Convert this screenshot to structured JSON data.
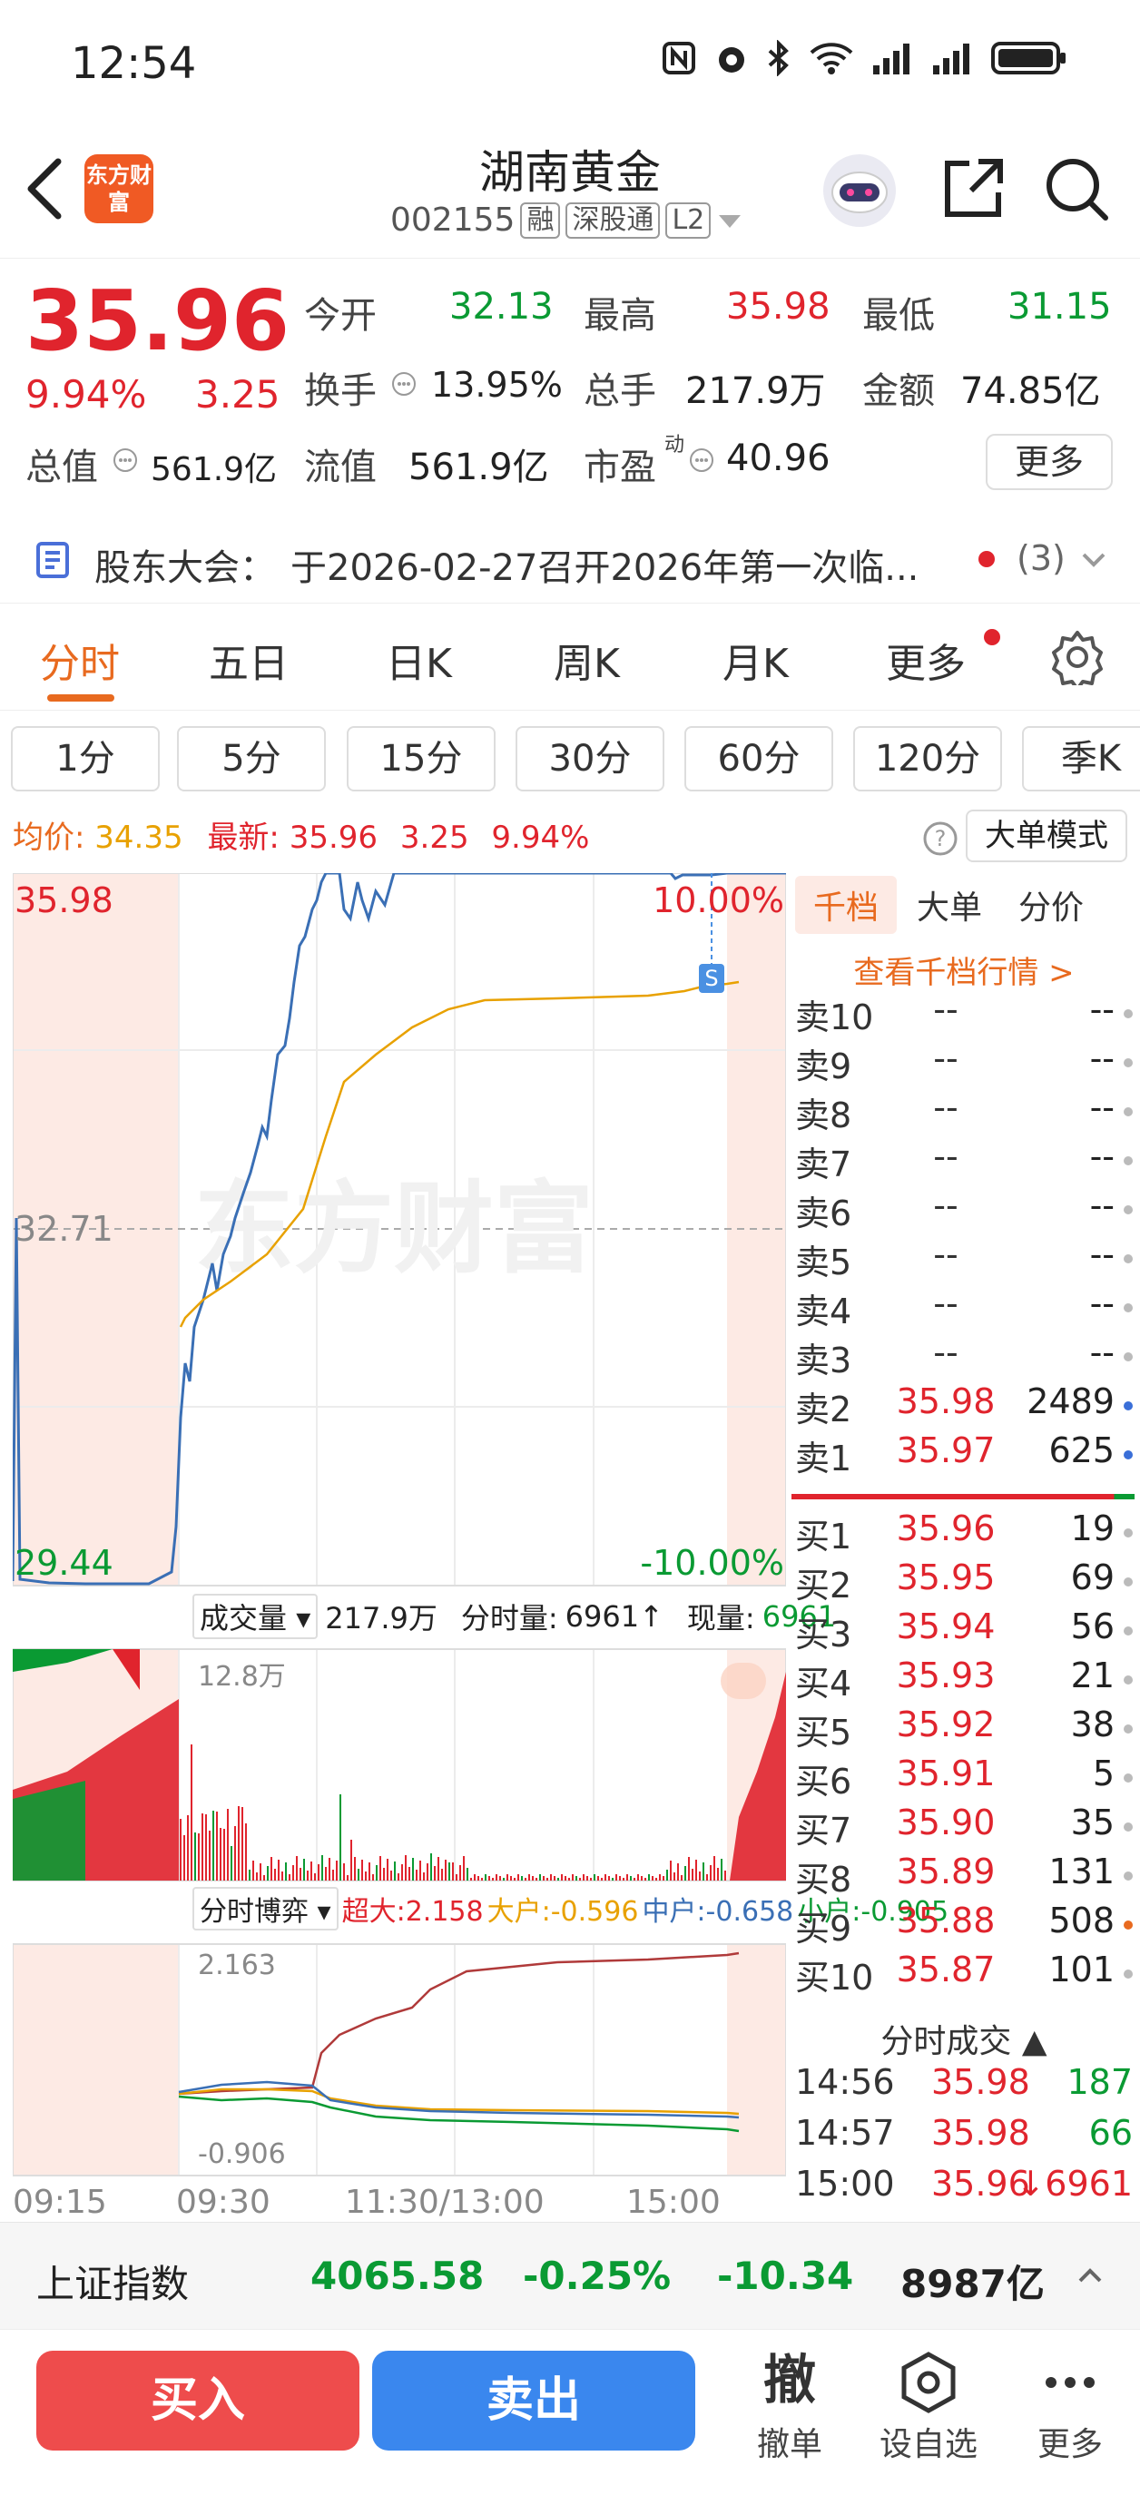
{
  "status_bar": {
    "time": "12:54"
  },
  "header": {
    "logo_text": "东方财富",
    "title": "湖南黄金",
    "code": "002155",
    "tags": [
      "融",
      "深股通",
      "L2"
    ]
  },
  "quote": {
    "price": "35.96",
    "change_pct": "9.94%",
    "change": "3.25",
    "fields": {
      "open_label": "今开",
      "open": "32.13",
      "high_label": "最高",
      "high": "35.98",
      "low_label": "最低",
      "low": "31.15",
      "turnover_label": "换手",
      "turnover": "13.95%",
      "volume_label": "总手",
      "volume": "217.9万",
      "amount_label": "金额",
      "amount": "74.85亿",
      "mktcap_label": "总值",
      "mktcap": "561.9亿",
      "float_label": "流值",
      "float": "561.9亿",
      "pe_label": "市盈",
      "pe_sup": "动",
      "pe": "40.96"
    },
    "more_label": "更多"
  },
  "notice": {
    "label": "股东大会：",
    "text": "于2026-02-27召开2026年第一次临...",
    "count": "(3)"
  },
  "tabs": [
    "分时",
    "五日",
    "日K",
    "周K",
    "月K",
    "更多"
  ],
  "periods": [
    "1分",
    "5分",
    "15分",
    "30分",
    "60分",
    "120分",
    "季K"
  ],
  "avg_row": {
    "avg_label": "均价:",
    "avg": "34.35",
    "latest_label": "最新:",
    "latest": "35.96",
    "chg": "3.25",
    "pct": "9.94%"
  },
  "big_order_mode": "大单模式",
  "chart": {
    "price_top": "35.98",
    "price_mid": "32.71",
    "price_bottom": "29.44",
    "pct_top": "10.00%",
    "pct_bottom": "-10.00%",
    "watermark": "东方财富",
    "s_marker": "S",
    "vol_selector": "成交量",
    "vol_total": "217.9万",
    "vol_period_label": "分时量:",
    "vol_period": "6961↑",
    "vol_now_label": "现量:",
    "vol_now": "6961",
    "vol_axis": "12.8万",
    "game_selector": "分时博弈",
    "game_big": "超大:2.158",
    "game_large": "大户:-0.596",
    "game_mid": "中户:-0.658",
    "game_small": "小户:-0.905",
    "game_top": "2.163",
    "game_bottom": "-0.906",
    "time_labels": [
      "09:15",
      "09:30",
      "11:30/13:00",
      "15:00"
    ]
  },
  "orderbook": {
    "tabs": [
      "千档",
      "大单",
      "分价"
    ],
    "link": "查看千档行情 >",
    "asks": [
      {
        "label": "卖10",
        "price": "--",
        "vol": "--"
      },
      {
        "label": "卖9",
        "price": "--",
        "vol": "--"
      },
      {
        "label": "卖8",
        "price": "--",
        "vol": "--"
      },
      {
        "label": "卖7",
        "price": "--",
        "vol": "--"
      },
      {
        "label": "卖6",
        "price": "--",
        "vol": "--"
      },
      {
        "label": "卖5",
        "price": "--",
        "vol": "--"
      },
      {
        "label": "卖4",
        "price": "--",
        "vol": "--"
      },
      {
        "label": "卖3",
        "price": "--",
        "vol": "--"
      },
      {
        "label": "卖2",
        "price": "35.98",
        "vol": "2489"
      },
      {
        "label": "卖1",
        "price": "35.97",
        "vol": "625"
      }
    ],
    "bids": [
      {
        "label": "买1",
        "price": "35.96",
        "vol": "19"
      },
      {
        "label": "买2",
        "price": "35.95",
        "vol": "69"
      },
      {
        "label": "买3",
        "price": "35.94",
        "vol": "56"
      },
      {
        "label": "买4",
        "price": "35.93",
        "vol": "21"
      },
      {
        "label": "买5",
        "price": "35.92",
        "vol": "38"
      },
      {
        "label": "买6",
        "price": "35.91",
        "vol": "5"
      },
      {
        "label": "买7",
        "price": "35.90",
        "vol": "35"
      },
      {
        "label": "买8",
        "price": "35.89",
        "vol": "131"
      },
      {
        "label": "买9",
        "price": "35.88",
        "vol": "508"
      },
      {
        "label": "买10",
        "price": "35.87",
        "vol": "101"
      }
    ],
    "trades_title": "分时成交",
    "trades": [
      {
        "time": "14:56",
        "price": "35.98",
        "vol": "187"
      },
      {
        "time": "14:57",
        "price": "35.98",
        "vol": "66"
      },
      {
        "time": "15:00",
        "price": "35.96",
        "vol": "↓6961"
      }
    ]
  },
  "index_bar": {
    "name": "上证指数",
    "value": "4065.58",
    "pct": "-0.25%",
    "chg": "-10.34",
    "amount": "8987亿"
  },
  "bottom": {
    "buy": "买入",
    "sell": "卖出",
    "cancel_icon": "撤",
    "cancel": "撤单",
    "watch": "设自选",
    "more": "更多"
  }
}
